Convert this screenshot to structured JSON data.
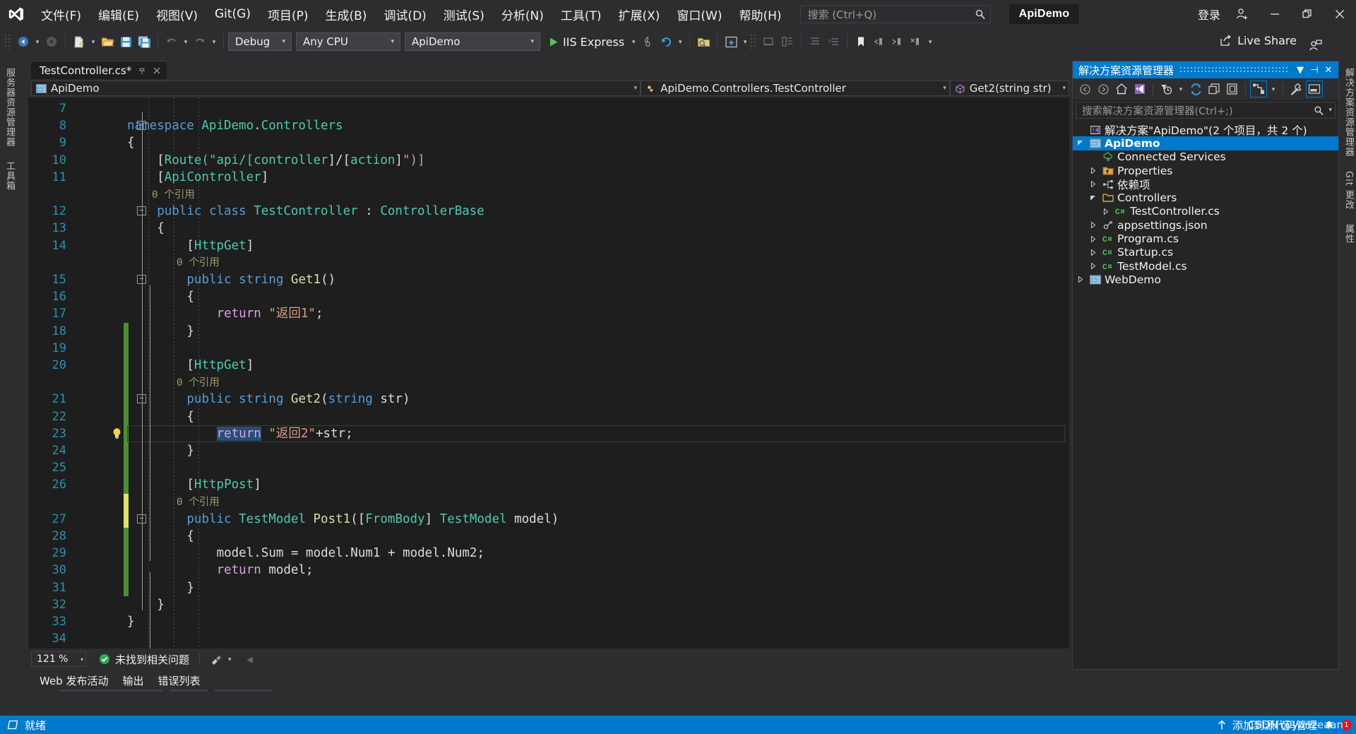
{
  "app": {
    "title": "ApiDemo",
    "logo_icon": "visual-studio-logo-icon"
  },
  "menu": {
    "items": [
      {
        "label": "文件(F)",
        "key": "F"
      },
      {
        "label": "编辑(E)",
        "key": "E"
      },
      {
        "label": "视图(V)",
        "key": "V"
      },
      {
        "label": "Git(G)",
        "key": "G"
      },
      {
        "label": "项目(P)",
        "key": "P"
      },
      {
        "label": "生成(B)",
        "key": "B"
      },
      {
        "label": "调试(D)",
        "key": "D"
      },
      {
        "label": "测试(S)",
        "key": "S"
      },
      {
        "label": "分析(N)",
        "key": "N"
      },
      {
        "label": "工具(T)",
        "key": "T"
      },
      {
        "label": "扩展(X)",
        "key": "X"
      },
      {
        "label": "窗口(W)",
        "key": "W"
      },
      {
        "label": "帮助(H)",
        "key": "H"
      }
    ]
  },
  "quick_search": {
    "placeholder": "搜索 (Ctrl+Q)",
    "value": "",
    "icon": "search-icon"
  },
  "titlebar": {
    "signin_label": "登录",
    "minimize": "—",
    "restore": "❐",
    "close": "✕"
  },
  "toolbar": {
    "configuration": "Debug",
    "platform": "Any CPU",
    "startup_project": "ApiDemo",
    "run_label": "IIS Express",
    "live_share_label": "Live Share"
  },
  "left_rail": {
    "tabs": [
      "服务器资源管理器",
      "工具箱"
    ]
  },
  "right_rail": {
    "tabs": [
      "解决方案资源管理器",
      "Git 更改",
      "属性"
    ]
  },
  "editor": {
    "tab": {
      "name": "TestController.cs*",
      "pin_icon": "pin-icon",
      "close_icon": "close-icon"
    },
    "nav": {
      "project": "ApiDemo",
      "type": "ApiDemo.Controllers.TestController",
      "member": "Get2(string str)"
    },
    "status": {
      "zoom": "121 %",
      "issues": "未找到相关问题"
    },
    "lines": [
      {
        "n": 7,
        "text": "",
        "change": "none"
      },
      {
        "n": 8,
        "text": "namespace ApiDemo.Controllers",
        "change": "none"
      },
      {
        "n": 9,
        "text": "{",
        "change": "none"
      },
      {
        "n": 10,
        "text": "    [Route(\"api/[controller]/[action]\")]",
        "change": "none"
      },
      {
        "n": 11,
        "text": "    [ApiController]",
        "change": "none"
      },
      {
        "n": "",
        "text": "    0 个引用",
        "change": "none"
      },
      {
        "n": 12,
        "text": "    public class TestController : ControllerBase",
        "change": "none"
      },
      {
        "n": 13,
        "text": "    {",
        "change": "none"
      },
      {
        "n": 14,
        "text": "        [HttpGet]",
        "change": "none"
      },
      {
        "n": "",
        "text": "        0 个引用",
        "change": "none"
      },
      {
        "n": 15,
        "text": "        public string Get1()",
        "change": "none"
      },
      {
        "n": 16,
        "text": "        {",
        "change": "none"
      },
      {
        "n": 17,
        "text": "            return \"返回1\";",
        "change": "none"
      },
      {
        "n": 18,
        "text": "        }",
        "change": "saved"
      },
      {
        "n": 19,
        "text": "",
        "change": "saved"
      },
      {
        "n": 20,
        "text": "        [HttpGet]",
        "change": "saved"
      },
      {
        "n": "",
        "text": "        0 个引用",
        "change": "saved"
      },
      {
        "n": 21,
        "text": "        public string Get2(string str)",
        "change": "saved"
      },
      {
        "n": 22,
        "text": "        {",
        "change": "saved"
      },
      {
        "n": 23,
        "text": "            return \"返回2\"+str;",
        "change": "saved"
      },
      {
        "n": 24,
        "text": "        }",
        "change": "saved"
      },
      {
        "n": 25,
        "text": "",
        "change": "saved"
      },
      {
        "n": 26,
        "text": "        [HttpPost]",
        "change": "saved"
      },
      {
        "n": "",
        "text": "        0 个引用",
        "change": "unsaved"
      },
      {
        "n": 27,
        "text": "        public TestModel Post1([FromBody] TestModel model)",
        "change": "unsaved"
      },
      {
        "n": 28,
        "text": "        {",
        "change": "saved"
      },
      {
        "n": 29,
        "text": "            model.Sum = model.Num1 + model.Num2;",
        "change": "saved"
      },
      {
        "n": 30,
        "text": "            return model;",
        "change": "saved"
      },
      {
        "n": 31,
        "text": "        }",
        "change": "saved"
      },
      {
        "n": 32,
        "text": "    }",
        "change": "none"
      },
      {
        "n": 33,
        "text": "}",
        "change": "none"
      },
      {
        "n": 34,
        "text": "",
        "change": "none"
      }
    ],
    "selection": "return",
    "bulb_line": 23,
    "bulb_icon": "lightbulb-icon"
  },
  "solution_explorer": {
    "title": "解决方案资源管理器",
    "window_controls": {
      "dropdown": "▼",
      "pin": "⊣",
      "close": "✕"
    },
    "toolbar_icons": [
      "back-arrow-icon",
      "forward-arrow-icon",
      "home-icon",
      "sync-with-active-document-icon",
      "pending-changes-filter-icon",
      "refresh-icon",
      "collapse-all-icon",
      "show-all-files-icon",
      "view-code-icon",
      "properties-icon",
      "preview-selected-items-icon"
    ],
    "search_placeholder": "搜索解决方案资源管理器(Ctrl+;)",
    "search_icon": "search-icon",
    "tree": [
      {
        "label": "解决方案\"ApiDemo\"(2 个项目，共 2 个)",
        "icon": "solution-icon",
        "depth": 0,
        "twisty": "",
        "selected": false
      },
      {
        "label": "ApiDemo",
        "icon": "web-project-icon",
        "depth": 0,
        "twisty": "expanded",
        "selected": true
      },
      {
        "label": "Connected Services",
        "icon": "connected-services-icon",
        "depth": 1,
        "twisty": "",
        "selected": false
      },
      {
        "label": "Properties",
        "icon": "properties-folder-icon",
        "depth": 1,
        "twisty": "collapsed",
        "selected": false
      },
      {
        "label": "依赖项",
        "icon": "dependencies-icon",
        "depth": 1,
        "twisty": "collapsed",
        "selected": false
      },
      {
        "label": "Controllers",
        "icon": "folder-icon",
        "depth": 1,
        "twisty": "expanded",
        "selected": false
      },
      {
        "label": "TestController.cs",
        "icon": "csharp-file-icon",
        "depth": 2,
        "twisty": "collapsed",
        "selected": false
      },
      {
        "label": "appsettings.json",
        "icon": "json-file-icon",
        "depth": 1,
        "twisty": "collapsed",
        "selected": false
      },
      {
        "label": "Program.cs",
        "icon": "csharp-file-icon",
        "depth": 1,
        "twisty": "collapsed",
        "selected": false
      },
      {
        "label": "Startup.cs",
        "icon": "csharp-file-icon",
        "depth": 1,
        "twisty": "collapsed",
        "selected": false
      },
      {
        "label": "TestModel.cs",
        "icon": "csharp-file-icon",
        "depth": 1,
        "twisty": "collapsed",
        "selected": false
      },
      {
        "label": "WebDemo",
        "icon": "web-project-icon",
        "depth": 0,
        "twisty": "collapsed",
        "selected": false
      }
    ]
  },
  "bottom_tabs": [
    {
      "label": "Web 发布活动"
    },
    {
      "label": "输出"
    },
    {
      "label": "错误列表"
    }
  ],
  "statusbar": {
    "state": "就绪",
    "state_icon": "ready-icon",
    "source_control_label": "添加到源代码管理",
    "source_control_icon": "up-arrow-icon",
    "notification_icon": "bell-icon",
    "notification_count": "1"
  },
  "watermark": {
    "text": "CSDN @yanzeaan"
  },
  "colors": {
    "accent": "#007acc",
    "titlebar_bg": "#2d2d30",
    "editor_bg": "#1e1e1e",
    "panel_bg": "#252526",
    "selection": "#264f78",
    "saved_change": "#4d8e35",
    "unsaved_change": "#e0e06a",
    "keyword": "#569cd6",
    "type": "#4ec9b0",
    "string": "#d69d85",
    "method": "#dcdcaa",
    "control": "#d8a0df",
    "linenumber": "#2b91af",
    "reference": "#9a9a6a"
  }
}
